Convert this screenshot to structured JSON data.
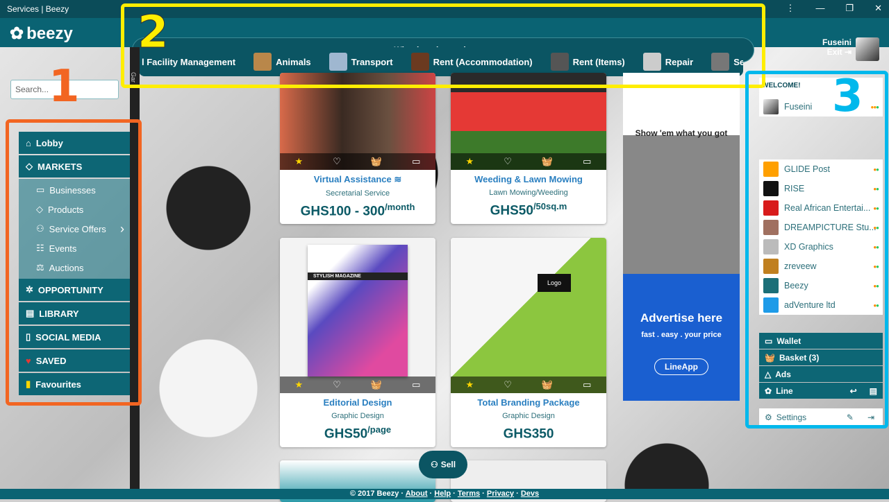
{
  "window": {
    "title": "Services | Beezy",
    "controls": [
      "⋮",
      "—",
      "❐",
      "✕"
    ]
  },
  "header": {
    "logo": "beezy",
    "search_placeholder": "What location and type...",
    "user_name": "Fuseini",
    "exit_label": "Exit"
  },
  "categories": [
    "l Facility Management",
    "Animals",
    "Transport",
    "Rent (Accommodation)",
    "Rent (Items)",
    "Repair",
    "Servicin"
  ],
  "sidebar": {
    "search_placeholder": "Search...",
    "items": [
      {
        "label": "Lobby",
        "icon": "⌂"
      },
      {
        "label": "MARKETS",
        "icon": "◇"
      }
    ],
    "sub_items": [
      {
        "label": "Businesses",
        "icon": "▭"
      },
      {
        "label": "Products",
        "icon": "◇"
      },
      {
        "label": "Service Offers",
        "icon": "⚇",
        "chevron": "›"
      },
      {
        "label": "Events",
        "icon": "☷"
      },
      {
        "label": "Auctions",
        "icon": "⚖"
      }
    ],
    "items2": [
      {
        "label": "OPPORTUNITY",
        "icon": "✲"
      },
      {
        "label": "LIBRARY",
        "icon": "▤"
      },
      {
        "label": "SOCIAL MEDIA",
        "icon": "▯"
      },
      {
        "label": "SAVED",
        "icon": "♥"
      },
      {
        "label": "Favourites",
        "icon": "▮"
      }
    ],
    "strip_label": "Gar"
  },
  "cards": [
    {
      "title": "Virtual Assistance",
      "sub": "Secretarial Service",
      "price": "GHS100 - 300",
      "unit": "/month"
    },
    {
      "title": "Weeding & Lawn Mowing",
      "sub": "Lawn Mowing/Weeding",
      "price": "GHS50",
      "unit": "/50sq.m"
    },
    {
      "title": "Editorial Design",
      "sub": "Graphic Design",
      "price": "GHS50",
      "unit": "/page",
      "img_text": "STYLISH MAGAZINE"
    },
    {
      "title": "Total Branding Package",
      "sub": "Graphic Design",
      "price": "GHS350",
      "unit": "",
      "img_text": "Logo"
    }
  ],
  "card_actions": [
    "★",
    "♡",
    "🧺",
    "▭"
  ],
  "ad": {
    "tagline": "Show 'em what you got",
    "headline": "Advertise here",
    "sub": "fast . easy . your price",
    "button": "LineApp"
  },
  "right_panel": {
    "welcome": "WELCOME!",
    "user": "Fuseini",
    "accounts": [
      {
        "name": "GLIDE Post",
        "color": "#ffa000"
      },
      {
        "name": "RISE",
        "color": "#111111"
      },
      {
        "name": "Real African Entertai...",
        "color": "#d81b1b"
      },
      {
        "name": "DREAMPICTURE Stu...",
        "color": "#a07060"
      },
      {
        "name": "XD Graphics",
        "color": "#bbbbbb"
      },
      {
        "name": "zreveew",
        "color": "#c08020"
      },
      {
        "name": "Beezy",
        "color": "#1b6f78"
      },
      {
        "name": "adVenture ltd",
        "color": "#1e9be8"
      }
    ],
    "buttons": [
      {
        "label": "Wallet",
        "icon": "▭"
      },
      {
        "label": "Basket (3)",
        "icon": "🧺"
      },
      {
        "label": "Ads",
        "icon": "△"
      },
      {
        "label": "Line",
        "icon": "✿"
      }
    ],
    "settings": "Settings"
  },
  "sell_label": "Sell",
  "footer": {
    "copyright": "© 2017 Beezy ·",
    "links": [
      "About",
      "Help",
      "Terms",
      "Privacy",
      "Devs"
    ]
  },
  "annotations": [
    {
      "n": "1",
      "color": "#f26522"
    },
    {
      "n": "2",
      "color": "#ffee00"
    },
    {
      "n": "3",
      "color": "#00b8ec"
    }
  ]
}
